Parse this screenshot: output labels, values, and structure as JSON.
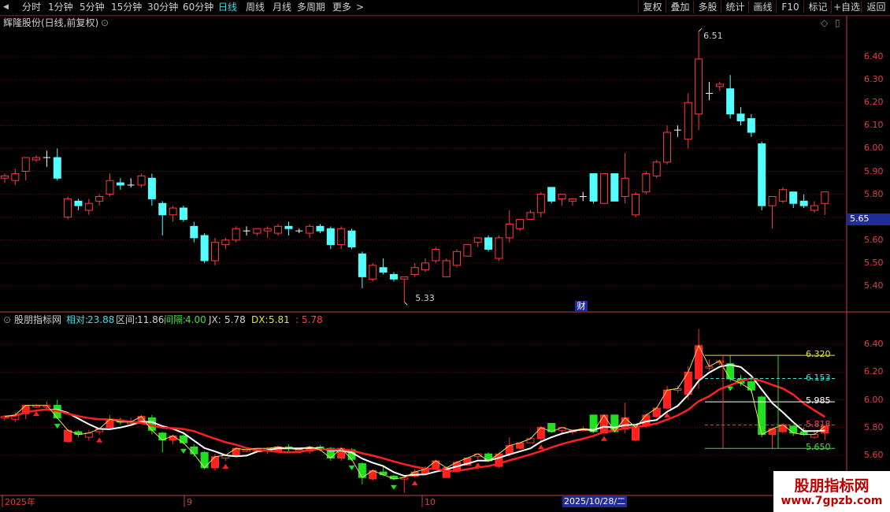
{
  "toolbar": {
    "back": "◀",
    "periods": [
      "分时",
      "1分钟",
      "5分钟",
      "15分钟",
      "30分钟",
      "60分钟",
      "日线",
      "周线",
      "月线",
      "多周期",
      "更多"
    ],
    "more_arrow": ">",
    "active_period": "日线",
    "right_buttons": [
      "复权",
      "叠加",
      "多股",
      "统计",
      "画线",
      "F10",
      "标记",
      "+自选",
      "返回"
    ]
  },
  "main_panel": {
    "title": "辉隆股份(日线,前复权)",
    "price_axis": [
      "6.40",
      "6.30",
      "6.20",
      "6.10",
      "6.00",
      "5.90",
      "5.80",
      "5.70",
      "5.60",
      "5.50",
      "5.40"
    ],
    "current_price": "5.65",
    "high_marker": "6.51",
    "low_marker": "5.33",
    "finance_marker": "财"
  },
  "indicator_panel": {
    "name": "股朋指标网",
    "values": [
      {
        "label": "相对:",
        "value": "23.88",
        "color": "#40e0e0"
      },
      {
        "label": "区间:",
        "value": "11.86",
        "color": "#d0d0d0"
      },
      {
        "label": "间隔:",
        "value": "4.00",
        "color": "#40e040"
      },
      {
        "label": "JX:",
        "value": "5.78",
        "color": "#d0d0d0"
      },
      {
        "label": "DX:",
        "value": "5.81",
        "color": "#e0e040"
      },
      {
        "label": ":",
        "value": "5.78",
        "color": "#ff4040"
      }
    ],
    "price_axis": [
      "6.40",
      "6.20",
      "6.00",
      "5.80",
      "5.60"
    ],
    "levels": [
      {
        "value": "6.320",
        "color": "#e0e040"
      },
      {
        "value": "6.153",
        "color": "#40e0e0"
      },
      {
        "value": "5.985",
        "color": "#ffffff"
      },
      {
        "value": "5.818",
        "color": "#ff4040"
      },
      {
        "value": "5.650",
        "color": "#40e040"
      }
    ]
  },
  "date_axis": {
    "labels": [
      "2025年",
      "9",
      "10"
    ],
    "cursor_date": "2025/10/28/二"
  },
  "watermark": {
    "title": "股朋指标网",
    "url": "www.7gpzb.com"
  },
  "colors": {
    "up": "#ff3c3c",
    "down": "#54ffff",
    "grid": "#7a0000",
    "axis": "#c84040",
    "active": "#38e0e0"
  },
  "chart_data": {
    "type": "candlestick",
    "candles": [
      [
        5.87,
        5.88,
        5.85,
        5.89
      ],
      [
        5.86,
        5.89,
        5.84,
        5.91
      ],
      [
        5.9,
        5.96,
        5.86,
        5.96
      ],
      [
        5.95,
        5.96,
        5.94,
        5.97
      ],
      [
        5.96,
        5.96,
        5.92,
        5.99
      ],
      [
        5.96,
        5.87,
        5.86,
        6.0
      ],
      [
        5.7,
        5.78,
        5.69,
        5.79
      ],
      [
        5.77,
        5.75,
        5.73,
        5.78
      ],
      [
        5.73,
        5.76,
        5.71,
        5.78
      ],
      [
        5.77,
        5.79,
        5.75,
        5.8
      ],
      [
        5.8,
        5.86,
        5.79,
        5.89
      ],
      [
        5.85,
        5.84,
        5.82,
        5.87
      ],
      [
        5.84,
        5.84,
        5.83,
        5.87
      ],
      [
        5.84,
        5.88,
        5.83,
        5.89
      ],
      [
        5.87,
        5.78,
        5.75,
        5.89
      ],
      [
        5.76,
        5.71,
        5.62,
        5.77
      ],
      [
        5.71,
        5.74,
        5.68,
        5.75
      ],
      [
        5.74,
        5.69,
        5.68,
        5.75
      ],
      [
        5.66,
        5.61,
        5.59,
        5.68
      ],
      [
        5.62,
        5.51,
        5.5,
        5.63
      ],
      [
        5.51,
        5.59,
        5.49,
        5.61
      ],
      [
        5.58,
        5.6,
        5.56,
        5.61
      ],
      [
        5.6,
        5.65,
        5.59,
        5.66
      ],
      [
        5.64,
        5.64,
        5.62,
        5.66
      ],
      [
        5.63,
        5.65,
        5.62,
        5.65
      ],
      [
        5.64,
        5.65,
        5.61,
        5.66
      ],
      [
        5.63,
        5.66,
        5.62,
        5.67
      ],
      [
        5.66,
        5.65,
        5.62,
        5.68
      ],
      [
        5.64,
        5.64,
        5.63,
        5.65
      ],
      [
        5.63,
        5.66,
        5.61,
        5.67
      ],
      [
        5.66,
        5.64,
        5.63,
        5.67
      ],
      [
        5.65,
        5.58,
        5.56,
        5.66
      ],
      [
        5.58,
        5.65,
        5.56,
        5.66
      ],
      [
        5.64,
        5.57,
        5.56,
        5.65
      ],
      [
        5.54,
        5.44,
        5.39,
        5.55
      ],
      [
        5.43,
        5.49,
        5.42,
        5.5
      ],
      [
        5.48,
        5.46,
        5.45,
        5.52
      ],
      [
        5.45,
        5.43,
        5.42,
        5.46
      ],
      [
        5.43,
        5.44,
        5.33,
        5.44
      ],
      [
        5.45,
        5.48,
        5.44,
        5.5
      ],
      [
        5.47,
        5.5,
        5.46,
        5.52
      ],
      [
        5.51,
        5.56,
        5.5,
        5.57
      ],
      [
        5.44,
        5.51,
        5.44,
        5.52
      ],
      [
        5.49,
        5.55,
        5.48,
        5.56
      ],
      [
        5.53,
        5.58,
        5.53,
        5.58
      ],
      [
        5.59,
        5.61,
        5.57,
        5.61
      ],
      [
        5.61,
        5.56,
        5.55,
        5.62
      ],
      [
        5.52,
        5.61,
        5.51,
        5.62
      ],
      [
        5.61,
        5.67,
        5.59,
        5.73
      ],
      [
        5.65,
        5.69,
        5.64,
        5.69
      ],
      [
        5.69,
        5.72,
        5.69,
        5.73
      ],
      [
        5.72,
        5.8,
        5.7,
        5.81
      ],
      [
        5.83,
        5.77,
        5.76,
        5.83
      ],
      [
        5.78,
        5.8,
        5.75,
        5.8
      ],
      [
        5.77,
        5.78,
        5.75,
        5.78
      ],
      [
        5.79,
        5.79,
        5.77,
        5.81
      ],
      [
        5.89,
        5.77,
        5.76,
        5.89
      ],
      [
        5.76,
        5.89,
        5.76,
        5.89
      ],
      [
        5.89,
        5.77,
        5.77,
        5.89
      ],
      [
        5.79,
        5.87,
        5.76,
        5.98
      ],
      [
        5.71,
        5.8,
        5.7,
        5.81
      ],
      [
        5.81,
        5.89,
        5.8,
        5.9
      ],
      [
        5.88,
        5.94,
        5.87,
        5.95
      ],
      [
        5.94,
        6.07,
        5.93,
        6.1
      ],
      [
        6.08,
        6.08,
        6.05,
        6.1
      ],
      [
        6.04,
        6.2,
        6.0,
        6.24
      ],
      [
        6.15,
        6.39,
        6.08,
        6.51
      ],
      [
        6.24,
        6.24,
        6.21,
        6.29
      ],
      [
        6.27,
        6.28,
        6.25,
        6.29
      ],
      [
        6.26,
        6.15,
        6.13,
        6.32
      ],
      [
        6.15,
        6.12,
        6.1,
        6.18
      ],
      [
        6.13,
        6.07,
        6.05,
        6.15
      ],
      [
        6.02,
        5.75,
        5.73,
        6.03
      ],
      [
        5.75,
        5.79,
        5.65,
        5.79
      ],
      [
        5.77,
        5.82,
        5.76,
        5.83
      ],
      [
        5.81,
        5.76,
        5.74,
        5.81
      ],
      [
        5.77,
        5.75,
        5.74,
        5.8
      ],
      [
        5.73,
        5.75,
        5.72,
        5.77
      ],
      [
        5.76,
        5.81,
        5.71,
        5.81
      ]
    ],
    "levels": [
      6.32,
      6.153,
      5.985,
      5.818,
      5.65
    ],
    "high": 6.51,
    "low": 5.33
  }
}
